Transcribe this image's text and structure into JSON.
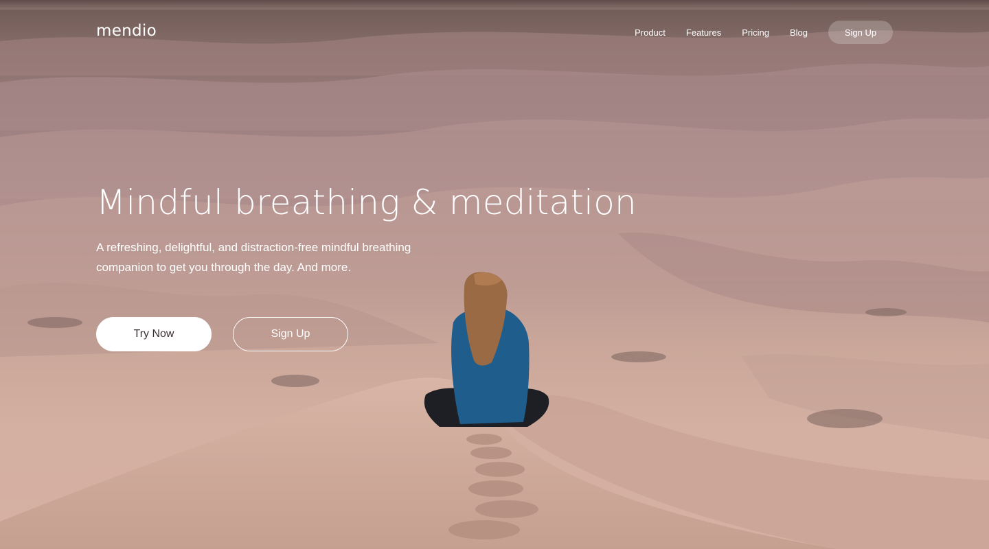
{
  "brand": {
    "logo_text": "mendio"
  },
  "nav": {
    "links": [
      "Product",
      "Features",
      "Pricing",
      "Blog"
    ],
    "signup_label": "Sign Up"
  },
  "hero": {
    "headline": "Mindful breathing & meditation",
    "subhead": "A refreshing, delightful, and distraction-free mindful breathing companion to get you through the day. And more.",
    "primary_cta": "Try Now",
    "secondary_cta": "Sign Up"
  },
  "colors": {
    "sand_light": "#d6b1a3",
    "sand_dark": "#8d7370",
    "jacket": "#1f5d8c",
    "hair": "#9a6a44"
  },
  "background_image": "desert-dunes-woman-meditating"
}
